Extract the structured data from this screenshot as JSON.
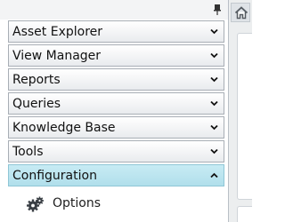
{
  "nav": {
    "sections": [
      {
        "label": "Asset Explorer",
        "expanded": false
      },
      {
        "label": "View Manager",
        "expanded": false
      },
      {
        "label": "Reports",
        "expanded": false
      },
      {
        "label": "Queries",
        "expanded": false
      },
      {
        "label": "Knowledge Base",
        "expanded": false
      },
      {
        "label": "Tools",
        "expanded": false
      },
      {
        "label": "Configuration",
        "expanded": true
      }
    ],
    "configuration_items": [
      {
        "label": "Options",
        "icon": "gears-icon"
      }
    ]
  },
  "icons": {
    "pin": "pin-icon",
    "home": "home-icon",
    "collapsed": "chevron-down-icon",
    "expanded": "chevron-up-icon"
  },
  "colors": {
    "active_header": "#b8e3ee",
    "header_border": "#a8aeb5",
    "text": "#111111"
  }
}
